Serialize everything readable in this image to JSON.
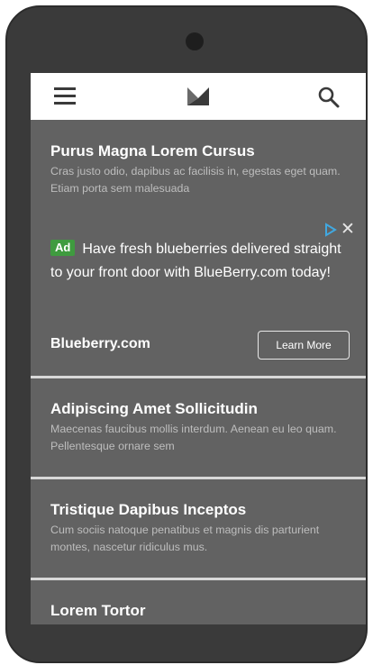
{
  "app": {
    "header": {
      "menu_icon": "hamburger-menu-icon",
      "logo_icon": "brand-logo-icon",
      "search_icon": "search-icon"
    }
  },
  "articles": [
    {
      "title": "Purus Magna Lorem Cursus",
      "desc": "Cras justo odio, dapibus ac facilisis in, egestas eget quam. Etiam porta sem malesuada"
    },
    {
      "title": "Adipiscing Amet Sollicitudin",
      "desc": "Maecenas faucibus mollis interdum. Aenean eu leo quam. Pellentesque ornare sem"
    },
    {
      "title": "Tristique Dapibus Inceptos",
      "desc": "Cum sociis natoque penatibus et magnis dis parturient montes, nascetur ridiculus mus."
    },
    {
      "title": "Lorem Tortor",
      "desc": ""
    }
  ],
  "ad": {
    "badge": "Ad",
    "headline": "Have fresh blueberries delivered straight to your front door with BlueBerry.com today!",
    "advertiser": "Blueberry.com",
    "cta": "Learn More",
    "close": "✕",
    "badge_color": "#3f9b3f",
    "adchoices_icon": "adchoices-icon"
  },
  "colors": {
    "screen_bg": "#626262",
    "phone_bg": "#3a3a3a",
    "header_bg": "#ffffff",
    "divider": "#d8d8d8"
  }
}
